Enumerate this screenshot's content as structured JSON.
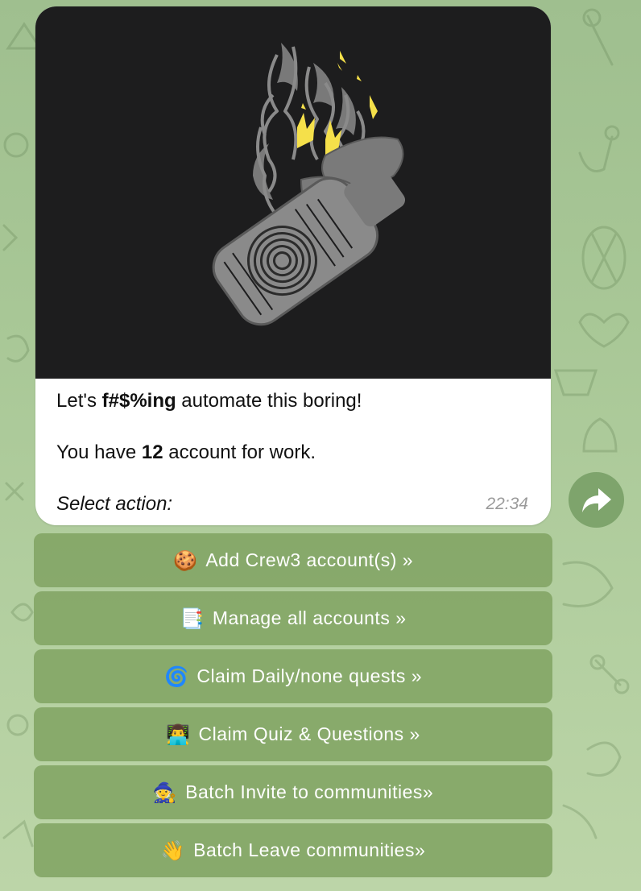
{
  "message": {
    "line1_prefix": "Let's ",
    "line1_bold": "f#$%ing",
    "line1_suffix": " automate this boring!",
    "line2_prefix": "You have ",
    "line2_bold": "12",
    "line2_suffix": " account for work.",
    "line3": "Select action:",
    "time": "22:34",
    "image_icon": "molotov-bottle-illustration"
  },
  "share": {
    "icon": "share-arrow-icon"
  },
  "buttons": [
    {
      "emoji": "🍪",
      "label": "Add Crew3 account(s) »"
    },
    {
      "emoji": "📑",
      "label": "Manage all accounts »"
    },
    {
      "emoji": "🌀",
      "label": "Claim Daily/none quests »"
    },
    {
      "emoji": "👨‍💻",
      "label": "Claim Quiz & Questions »"
    },
    {
      "emoji": "🧙",
      "label": "Batch Invite to communities»"
    },
    {
      "emoji": "👋",
      "label": "Batch Leave communities»"
    }
  ],
  "colors": {
    "background": "#a8c796",
    "button": "#83a565",
    "share_button": "#7ea46c",
    "photo_bg": "#1d1d1e",
    "flame_yellow": "#f5e04a",
    "art_gray": "#8a8a8a"
  }
}
